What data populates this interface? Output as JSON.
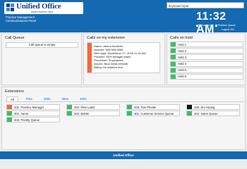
{
  "header": {
    "logo_name": "Unified Office",
    "logo_tagline": "total connect now",
    "subtitle_1": "Practice Management",
    "subtitle_2": "Communications Panel",
    "keyboard_input_value": "keyboard input",
    "clock": "11:32 AM",
    "status_receptionist": "Receptionist",
    "status_practice_queue": "Practice Queue",
    "logout": "Logout 201"
  },
  "call_queue": {
    "title": "Call Queue",
    "empty_text": "Call queue is empty"
  },
  "calls_on_extension": {
    "title": "Calls on my extension",
    "status_color": "#ef6a3d",
    "lines": [
      "Name: Janine Andrews",
      "Number: 555-555-5555",
      "Next Appt: September 27, 2018 11:15 AM",
      "Provider: RDH Meagan Mallo",
      "Procedure: Prophylaxis",
      "Insurer: Blue Delta eHealth",
      "Billing: No balance due"
    ]
  },
  "calls_on_hold": {
    "title": "Calls on hold",
    "status_color": "#3dbd6b",
    "items": [
      "Hold 1",
      "Hold 2",
      "Hold 3",
      "Hold 4",
      "Hold 5",
      "Hold 6"
    ]
  },
  "extensions": {
    "title": "Extensions",
    "tabs": [
      "All",
      "Pete",
      "200s",
      "300s",
      "400s"
    ],
    "active_tab": "All",
    "colors": {
      "busy": "#ef6a3d",
      "available": "#3dbd6b",
      "offline": "#111111"
    },
    "columns": [
      [
        {
          "label": "201: Practice Manager",
          "status": "busy"
        },
        {
          "label": "301: Aaron",
          "status": "available"
        },
        {
          "label": "403: Priority Queue",
          "status": "available"
        }
      ],
      [
        {
          "label": "202: Pete Labet",
          "status": "available"
        },
        {
          "label": "302: BobW",
          "status": "available"
        }
      ],
      [
        {
          "label": "203: Tom Phelan",
          "status": "available"
        },
        {
          "label": "401: Customer Service Queue",
          "status": "available"
        }
      ],
      [
        {
          "label": "205: Jim Huang",
          "status": "offline"
        },
        {
          "label": "402: Sales Queue",
          "status": "available"
        }
      ]
    ]
  },
  "footer": {
    "text": "Unified Office"
  }
}
